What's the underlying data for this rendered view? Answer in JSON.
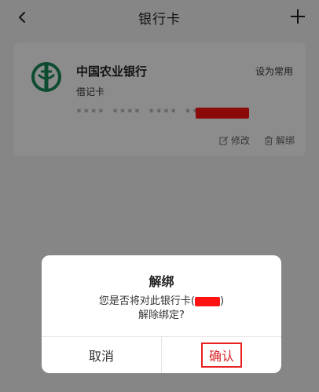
{
  "header": {
    "title": "银行卡",
    "back_icon": "back-chevron-icon",
    "add_icon": "plus-icon"
  },
  "card": {
    "bank_name": "中国农业银行",
    "card_type": "借记卡",
    "set_default_label": "设为常用",
    "number_masked": "**** **** **** ****",
    "edit_label": "修改",
    "unbind_label": "解绑",
    "logo_color": "#1a8a5a"
  },
  "dialog": {
    "title": "解绑",
    "message_prefix": "您是否将对此银行卡(",
    "message_suffix": ")",
    "message_line2": "解除绑定?",
    "cancel_label": "取消",
    "confirm_label": "确认"
  },
  "colors": {
    "accent_red": "#d9272b",
    "redaction": "#ff1212"
  }
}
